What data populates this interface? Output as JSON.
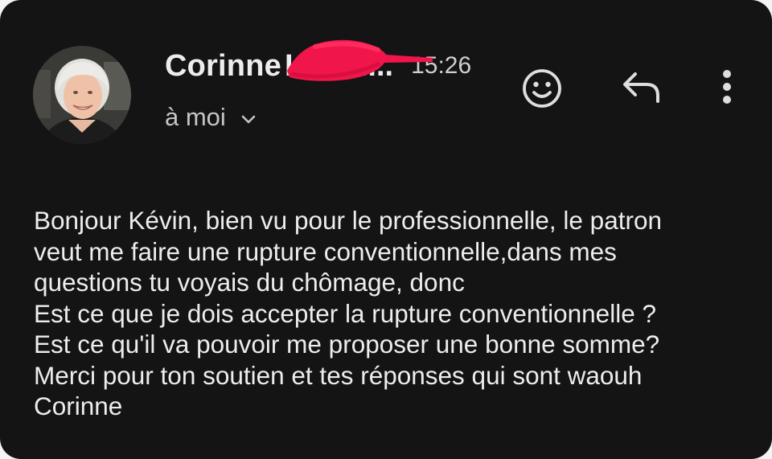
{
  "email": {
    "sender": {
      "name": "Corinne",
      "name_rest": "L... Cl...",
      "avatar": "person-photo"
    },
    "time": "15:26",
    "recipient": "à moi",
    "actions": {
      "react_icon": "smiley-icon",
      "reply_icon": "reply-arrow-icon",
      "more_icon": "vertical-dots-icon"
    },
    "body_lines": [
      "Bonjour Kévin,  bien vu pour le professionnelle,  le patron",
      "veut me faire une rupture conventionnelle,dans mes",
      "questions tu voyais du chômage, donc",
      "Est ce que je dois accepter la rupture conventionnelle ?",
      "Est ce qu'il va pouvoir me proposer une bonne somme?",
      "Merci pour ton soutien et tes réponses qui sont waouh",
      "Corinne"
    ]
  },
  "colors": {
    "background": "#141414",
    "text": "#ededed",
    "muted": "#c6c6c6",
    "redaction": "#f0154a"
  }
}
